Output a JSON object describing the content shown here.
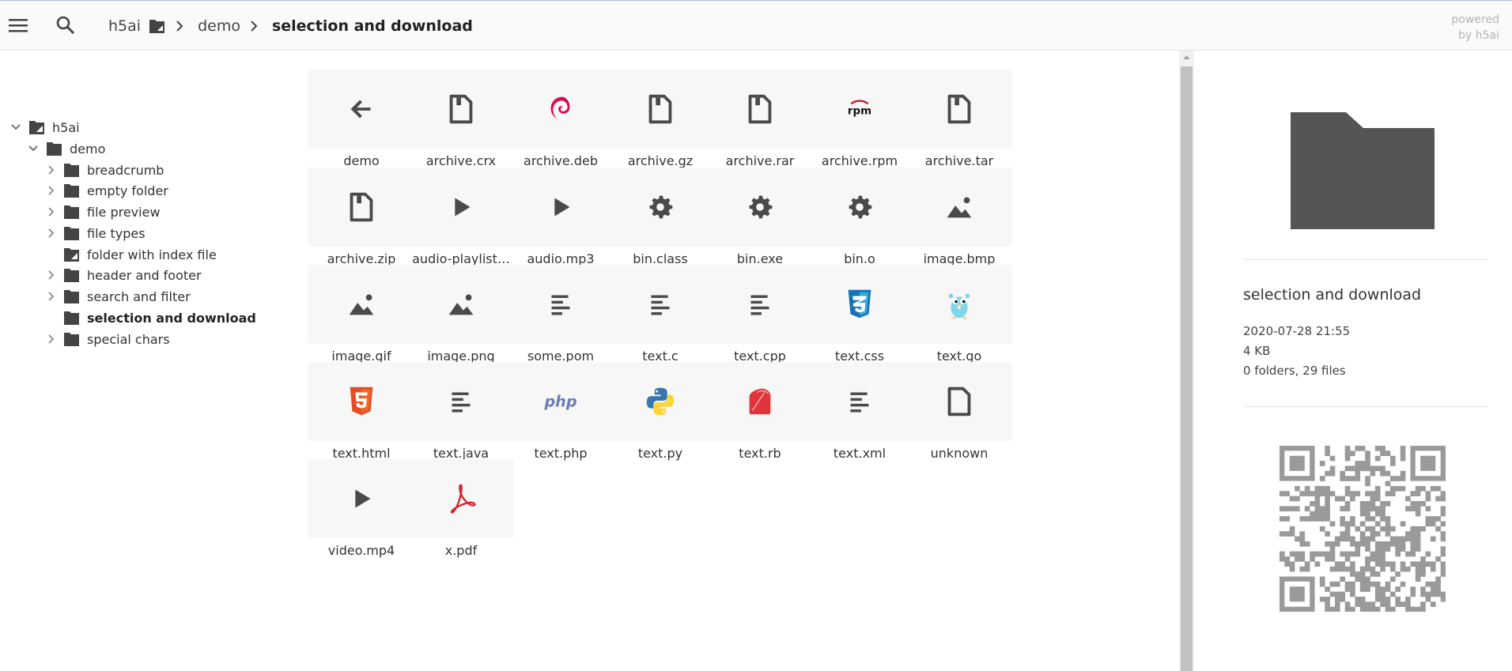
{
  "topbar": {
    "menu_icon": "menu-icon",
    "search_icon": "search-icon",
    "breadcrumb": [
      {
        "label": "h5ai",
        "icon": "folder-home-icon"
      },
      {
        "label": "demo"
      },
      {
        "label": "selection and download",
        "active": true
      }
    ],
    "powered_line1": "powered",
    "powered_line2": "by h5ai"
  },
  "tree": [
    {
      "label": "h5ai",
      "depth": 0,
      "toggle": "open",
      "icon": "folder-page-icon"
    },
    {
      "label": "demo",
      "depth": 1,
      "toggle": "open",
      "icon": "folder-icon"
    },
    {
      "label": "breadcrumb",
      "depth": 2,
      "toggle": "closed",
      "icon": "folder-icon"
    },
    {
      "label": "empty folder",
      "depth": 2,
      "toggle": "closed",
      "icon": "folder-icon"
    },
    {
      "label": "file preview",
      "depth": 2,
      "toggle": "closed",
      "icon": "folder-icon"
    },
    {
      "label": "file types",
      "depth": 2,
      "toggle": "closed",
      "icon": "folder-icon"
    },
    {
      "label": "folder with index file",
      "depth": 2,
      "toggle": "none",
      "icon": "folder-page-icon"
    },
    {
      "label": "header and footer",
      "depth": 2,
      "toggle": "closed",
      "icon": "folder-icon"
    },
    {
      "label": "search and filter",
      "depth": 2,
      "toggle": "closed",
      "icon": "folder-icon"
    },
    {
      "label": "selection and download",
      "depth": 2,
      "toggle": "none",
      "icon": "folder-icon",
      "active": true
    },
    {
      "label": "special chars",
      "depth": 2,
      "toggle": "closed",
      "icon": "folder-icon"
    }
  ],
  "items": [
    {
      "label": "demo",
      "icon": "back-arrow-icon"
    },
    {
      "label": "archive.crx",
      "icon": "archive-icon"
    },
    {
      "label": "archive.deb",
      "icon": "debian-icon"
    },
    {
      "label": "archive.gz",
      "icon": "archive-icon"
    },
    {
      "label": "archive.rar",
      "icon": "archive-icon"
    },
    {
      "label": "archive.rpm",
      "icon": "rpm-icon"
    },
    {
      "label": "archive.tar",
      "icon": "archive-icon"
    },
    {
      "label": "archive.zip",
      "icon": "archive-icon"
    },
    {
      "label": "audio-playlist…",
      "icon": "play-icon"
    },
    {
      "label": "audio.mp3",
      "icon": "play-icon"
    },
    {
      "label": "bin.class",
      "icon": "gear-icon"
    },
    {
      "label": "bin.exe",
      "icon": "gear-icon"
    },
    {
      "label": "bin.o",
      "icon": "gear-icon"
    },
    {
      "label": "image.bmp",
      "icon": "image-icon"
    },
    {
      "label": "image.gif",
      "icon": "image-icon"
    },
    {
      "label": "image.png",
      "icon": "image-icon"
    },
    {
      "label": "some.pom",
      "icon": "text-lines-icon"
    },
    {
      "label": "text.c",
      "icon": "text-lines-icon"
    },
    {
      "label": "text.cpp",
      "icon": "text-lines-icon"
    },
    {
      "label": "text.css",
      "icon": "css3-icon"
    },
    {
      "label": "text.go",
      "icon": "gopher-icon"
    },
    {
      "label": "text.html",
      "icon": "html5-icon"
    },
    {
      "label": "text.java",
      "icon": "text-lines-icon"
    },
    {
      "label": "text.php",
      "icon": "php-icon"
    },
    {
      "label": "text.py",
      "icon": "python-icon"
    },
    {
      "label": "text.rb",
      "icon": "ruby-icon"
    },
    {
      "label": "text.xml",
      "icon": "text-lines-icon"
    },
    {
      "label": "unknown",
      "icon": "blank-file-icon"
    },
    {
      "label": "video.mp4",
      "icon": "play-icon"
    },
    {
      "label": "x.pdf",
      "icon": "pdf-icon"
    }
  ],
  "info": {
    "icon": "folder-large-icon",
    "name": "selection and download",
    "date": "2020-07-28 21:55",
    "size": "4 KB",
    "counts": "0 folders, 29 files",
    "qr": "qr-code-icon"
  },
  "colors": {
    "icon_gray": "#4a4a4a",
    "thumb_bg": "#f7f7f7",
    "debian": "#d70a53",
    "css3": "#1572b6",
    "html5": "#e44d26",
    "php": "#6c7eb7",
    "ruby": "#e0353b",
    "pdf": "#d8232a",
    "gopher": "#7fd5ea",
    "python_blue": "#3776ab",
    "python_yellow": "#ffd43b"
  }
}
